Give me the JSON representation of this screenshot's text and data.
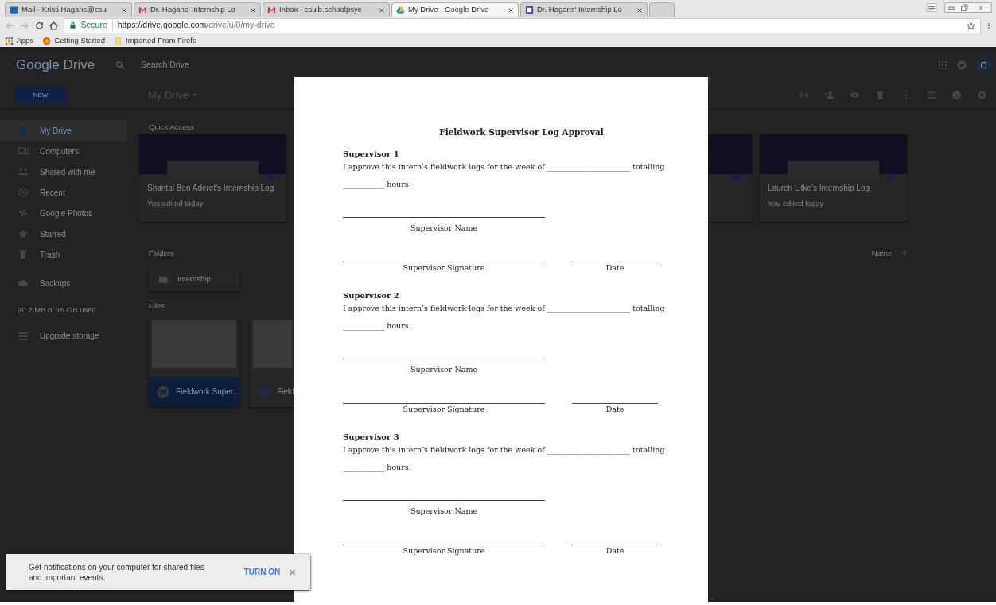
{
  "browser": {
    "tabs": [
      {
        "title": "Mail - Kristi.Hagans@csu",
        "selected": false
      },
      {
        "title": "Dr. Hagans' Internship Lo",
        "selected": false
      },
      {
        "title": "Inbox - csulb.schoolpsyc",
        "selected": false
      },
      {
        "title": "My Drive - Google Drive",
        "selected": true
      },
      {
        "title": "Dr. Hagans' Internship Lo",
        "selected": false
      }
    ],
    "secure_label": "Secure",
    "url_host": "https://drive.google.com",
    "url_path": "/drive/u/0/my-drive",
    "bookmarks": [
      "Apps",
      "Getting Started",
      "Imported From Firefo"
    ]
  },
  "drive": {
    "logo_word1": "Google",
    "logo_word2": "Drive",
    "search_placeholder": "Search Drive",
    "avatar": "C",
    "new_button": "NEW",
    "location": "My Drive",
    "sidebar": {
      "items": [
        {
          "label": "My Drive",
          "selected": true
        },
        {
          "label": "Computers",
          "selected": false
        },
        {
          "label": "Shared with me",
          "selected": false
        },
        {
          "label": "Recent",
          "selected": false
        },
        {
          "label": "Google Photos",
          "selected": false
        },
        {
          "label": "Starred",
          "selected": false
        },
        {
          "label": "Trash",
          "selected": false
        },
        {
          "label": "Backups",
          "selected": false
        }
      ],
      "usage": "20.2 MB of 15 GB used",
      "upgrade": "Upgrade storage"
    },
    "quick_access_heading": "Quick Access",
    "quick_access": [
      {
        "kind": "doc",
        "title": "Shantal Ben Aderet's Internship Log",
        "subtitle": "You edited today"
      },
      {
        "kind": "partial"
      },
      {
        "kind": "doc",
        "title": "Lauren Litke's Internship Log",
        "subtitle": "You edited today"
      }
    ],
    "folders_heading": "Folders",
    "sort_label": "Name",
    "folders": [
      "Internship"
    ],
    "files_heading": "Files",
    "files": [
      {
        "name": "Fieldwork Super...",
        "selected": true
      },
      {
        "name": "Field",
        "selected": false
      }
    ]
  },
  "document": {
    "title": "Fieldwork Supervisor Log Approval",
    "sections": [
      {
        "heading": "Supervisor 1",
        "sentence": "I approve this intern’s fieldwork logs for the week of ______________________ totalling",
        "hours": "___________ hours.",
        "name_label": "Supervisor Name",
        "signature_label": "Supervisor Signature",
        "date_label": "Date"
      },
      {
        "heading": "Supervisor 2",
        "sentence": "I approve this intern’s fieldwork logs for the week of ______________________ totalling",
        "hours": "___________ hours.",
        "name_label": "Supervisor Name",
        "signature_label": "Supervisor Signature",
        "date_label": "Date"
      },
      {
        "heading": "Supervisor 3",
        "sentence": "I approve this intern’s fieldwork logs for the week of ______________________ totalling",
        "hours": "___________ hours.",
        "name_label": "Supervisor Name",
        "signature_label": "Supervisor Signature",
        "date_label": "Date"
      }
    ]
  },
  "notification": {
    "message": "Get notifications on your computer for shared files and important events.",
    "action": "TURN ON",
    "close": "×"
  }
}
